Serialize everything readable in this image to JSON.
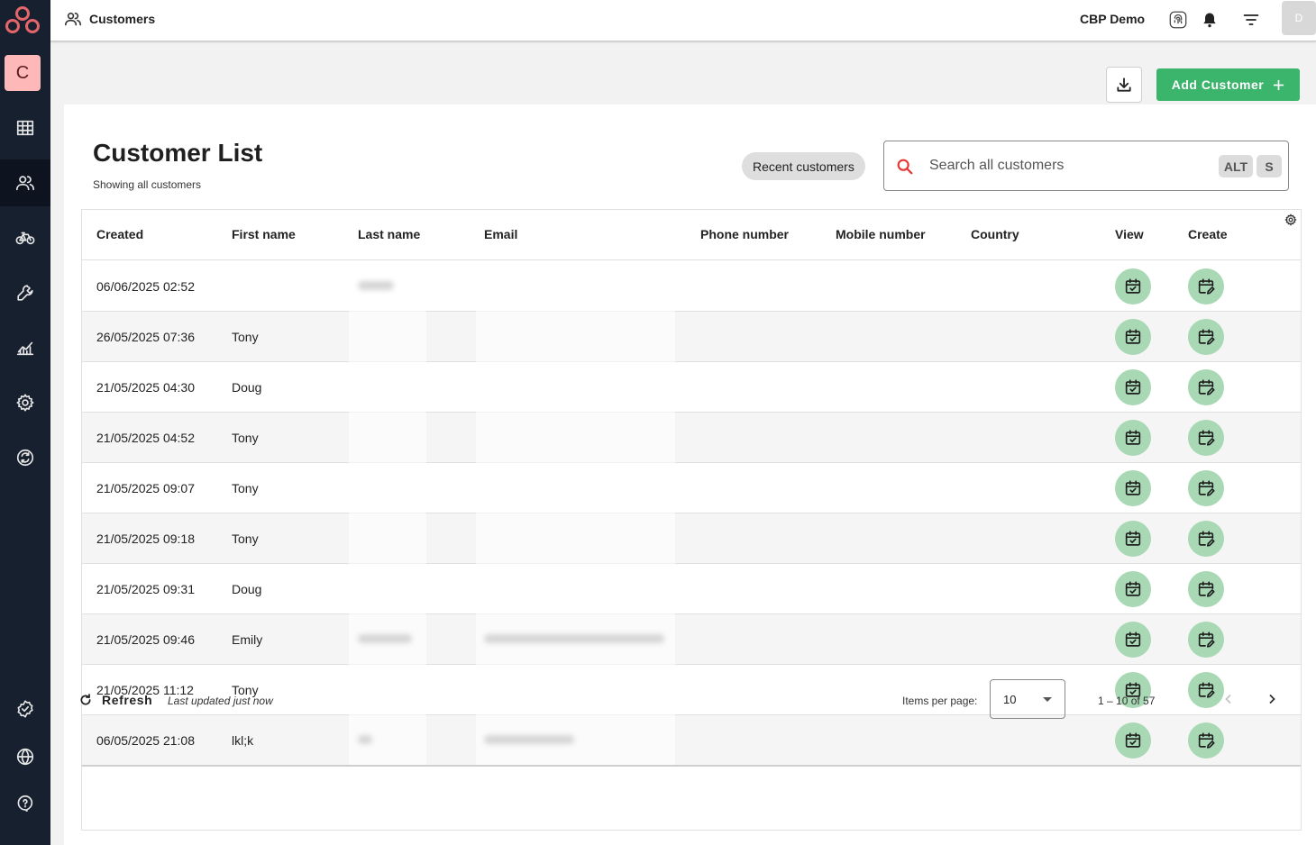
{
  "sidebar": {
    "account_initial": "C",
    "items": [
      {
        "name": "dashboard",
        "icon": "grid-icon"
      },
      {
        "name": "customers",
        "icon": "people-icon",
        "active": true
      },
      {
        "name": "bikes",
        "icon": "bicycle-icon"
      },
      {
        "name": "workshop",
        "icon": "wrench-icon"
      },
      {
        "name": "reports",
        "icon": "chart-icon"
      },
      {
        "name": "settings",
        "icon": "gear-icon"
      },
      {
        "name": "sync",
        "icon": "sync-icon"
      }
    ],
    "bottom_items": [
      {
        "name": "verified",
        "icon": "badge-check-icon"
      },
      {
        "name": "language",
        "icon": "globe-icon"
      },
      {
        "name": "help",
        "icon": "help-icon"
      }
    ]
  },
  "topbar": {
    "title": "Customers",
    "org_name": "CBP Demo",
    "user_initial": "D"
  },
  "actions": {
    "add_label": "Add Customer"
  },
  "card": {
    "title": "Customer List",
    "subtitle": "Showing all customers",
    "recent_label": "Recent customers",
    "search_placeholder": "Search all customers",
    "shortcut_keys": [
      "ALT",
      "S"
    ]
  },
  "table": {
    "columns": [
      "Created",
      "First name",
      "Last name",
      "Email",
      "Phone number",
      "Mobile number",
      "Country",
      "View",
      "Create"
    ],
    "rows": [
      {
        "created": "06/06/2025 02:52",
        "first_name": ""
      },
      {
        "created": "26/05/2025 07:36",
        "first_name": "Tony"
      },
      {
        "created": "21/05/2025 04:30",
        "first_name": "Doug"
      },
      {
        "created": "21/05/2025 04:52",
        "first_name": "Tony"
      },
      {
        "created": "21/05/2025 09:07",
        "first_name": "Tony"
      },
      {
        "created": "21/05/2025 09:18",
        "first_name": "Tony"
      },
      {
        "created": "21/05/2025 09:31",
        "first_name": "Doug"
      },
      {
        "created": "21/05/2025 09:46",
        "first_name": "Emily"
      },
      {
        "created": "21/05/2025 11:12",
        "first_name": "Tony"
      },
      {
        "created": "06/05/2025 21:08",
        "first_name": "lkl;k"
      }
    ]
  },
  "footer": {
    "refresh_label": "Refresh",
    "last_updated": "Last updated just now",
    "items_per_page_label": "Items per page:",
    "items_per_page": "10",
    "range": "1 – 10 of 57"
  },
  "colors": {
    "sidebar_bg": "#17202e",
    "accent_green": "#3cb56c",
    "icon_button_bg": "#a8d8b4",
    "search_icon_red": "#e53935"
  }
}
